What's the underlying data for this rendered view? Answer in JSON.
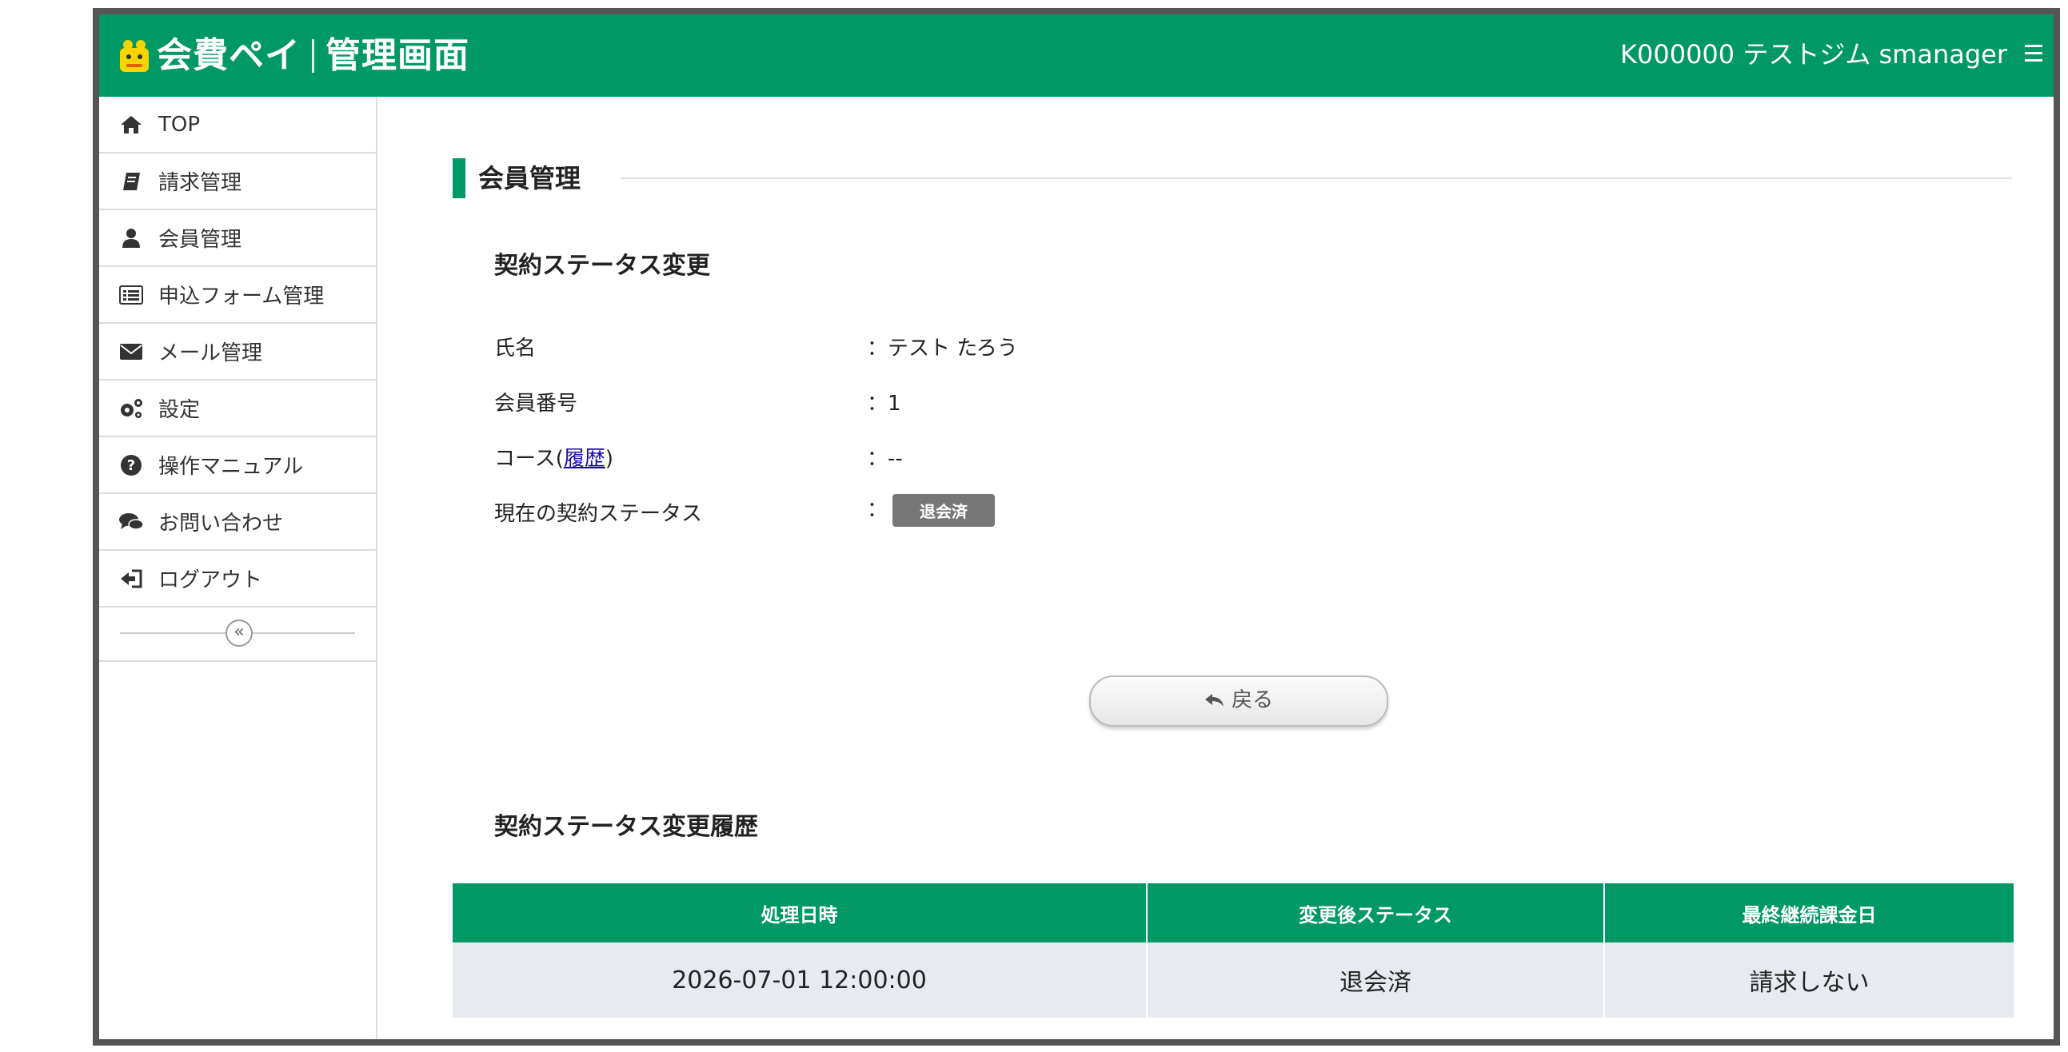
{
  "header": {
    "logo_text": "会費ペイ",
    "logo_subtitle": "管理画面",
    "user_info": "K000000 テストジム smanager"
  },
  "sidebar": {
    "items": [
      {
        "label": "TOP",
        "icon": "home-icon"
      },
      {
        "label": "請求管理",
        "icon": "book-icon"
      },
      {
        "label": "会員管理",
        "icon": "user-icon"
      },
      {
        "label": "申込フォーム管理",
        "icon": "list-icon"
      },
      {
        "label": "メール管理",
        "icon": "envelope-icon"
      },
      {
        "label": "設定",
        "icon": "gears-icon"
      },
      {
        "label": "操作マニュアル",
        "icon": "question-circle-icon"
      },
      {
        "label": "お問い合わせ",
        "icon": "comments-icon"
      },
      {
        "label": "ログアウト",
        "icon": "sign-out-icon"
      }
    ],
    "collapse_symbol": "«"
  },
  "main": {
    "section_title": "会員管理",
    "subheading": "契約ステータス変更",
    "fields": {
      "name_label": "氏名",
      "name_value": "：テスト たろう",
      "member_no_label": "会員番号",
      "member_no_value": "：1",
      "course_label_prefix": "コース(",
      "course_link": "履歴",
      "course_label_suffix": ")",
      "course_value": "：--",
      "status_label": "現在の契約ステータス",
      "status_colon": "：",
      "status_badge": "退会済"
    },
    "back_button": "戻る",
    "history_heading": "契約ステータス変更履歴",
    "history_table": {
      "headers": [
        "処理日時",
        "変更後ステータス",
        "最終継続課金日"
      ],
      "rows": [
        [
          "2026-07-01 12:00:00",
          "退会済",
          "請求しない"
        ]
      ]
    }
  },
  "colors": {
    "brand_green": "#009966",
    "badge_gray": "#777777",
    "row_bg": "#e7eaf0"
  }
}
